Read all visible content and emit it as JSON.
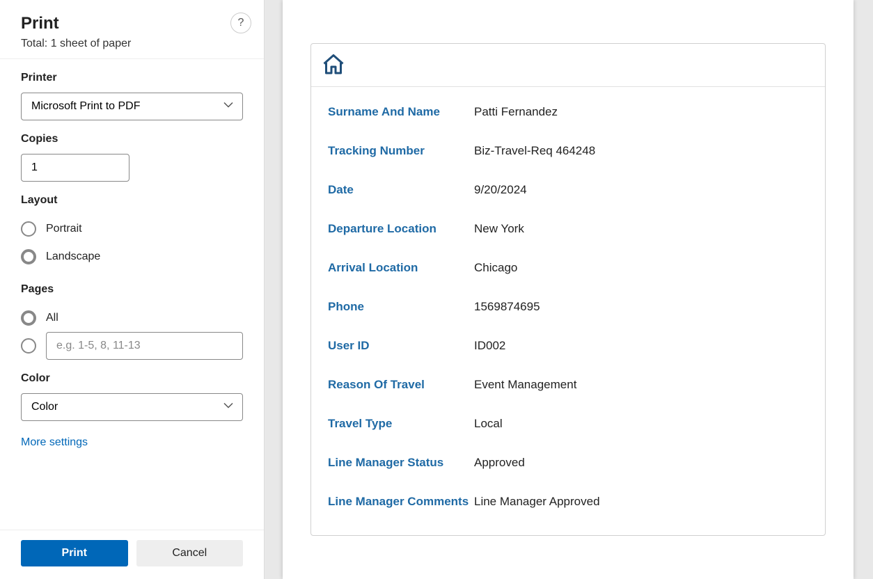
{
  "panel": {
    "title": "Print",
    "subtitle": "Total: 1 sheet of paper",
    "help_label": "?",
    "printer_label": "Printer",
    "printer_value": "Microsoft Print to PDF",
    "copies_label": "Copies",
    "copies_value": "1",
    "layout_label": "Layout",
    "layout_portrait": "Portrait",
    "layout_landscape": "Landscape",
    "layout_selected": "landscape",
    "pages_label": "Pages",
    "pages_all": "All",
    "pages_selected": "all",
    "pages_custom_placeholder": "e.g. 1-5, 8, 11-13",
    "color_label": "Color",
    "color_value": "Color",
    "more_settings": "More settings",
    "print_button": "Print",
    "cancel_button": "Cancel"
  },
  "doc": {
    "fields": [
      {
        "label": "Surname And Name",
        "value": "Patti Fernandez"
      },
      {
        "label": "Tracking Number",
        "value": "Biz-Travel-Req 464248"
      },
      {
        "label": "Date",
        "value": "9/20/2024"
      },
      {
        "label": "Departure Location",
        "value": "New York"
      },
      {
        "label": "Arrival Location",
        "value": "Chicago"
      },
      {
        "label": "Phone",
        "value": "1569874695"
      },
      {
        "label": "User ID",
        "value": "ID002"
      },
      {
        "label": "Reason Of Travel",
        "value": "Event Management"
      },
      {
        "label": "Travel Type",
        "value": "Local"
      },
      {
        "label": "Line Manager Status",
        "value": "Approved"
      },
      {
        "label": "Line Manager Comments",
        "value": "Line Manager Approved"
      }
    ]
  }
}
